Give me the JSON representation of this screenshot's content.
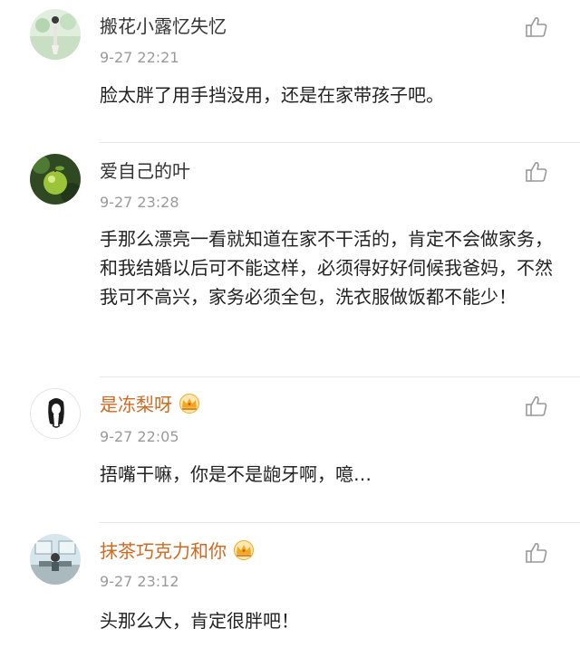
{
  "comments": [
    {
      "name": "搬花小露忆失忆",
      "time": "9-27 22:21",
      "text": "脸太胖了用手挡没用，还是在家带孩子吧。",
      "vip": false,
      "avatar_icon": "scenery-avatar-icon"
    },
    {
      "name": "爱自己的叶",
      "time": "9-27 23:28",
      "text": "手那么漂亮一看就知道在家不干活的，肯定不会做家务，和我结婚以后可不能这样，必须得好好伺候我爸妈，不然我可不高兴，家务必须全包，洗衣服做饭都不能少！",
      "vip": false,
      "avatar_icon": "apple-avatar-icon"
    },
    {
      "name": "是冻梨呀",
      "time": "9-27 22:05",
      "text": "捂嘴干嘛，你是不是龅牙啊，噫…",
      "vip": true,
      "avatar_icon": "girl-sketch-avatar-icon"
    },
    {
      "name": "抹茶巧克力和你",
      "time": "9-27 23:12",
      "text": "头那么大，肯定很胖吧！",
      "vip": true,
      "avatar_icon": "classroom-avatar-icon"
    }
  ],
  "icons": {
    "like": "thumbs-up-icon",
    "vip": "crown-icon"
  },
  "colors": {
    "name_regular": "#333333",
    "name_vip": "#d2691e",
    "time": "#9a9a9a",
    "text": "#222222",
    "divider": "#e6e6e6",
    "crown": "#f0a91e"
  }
}
